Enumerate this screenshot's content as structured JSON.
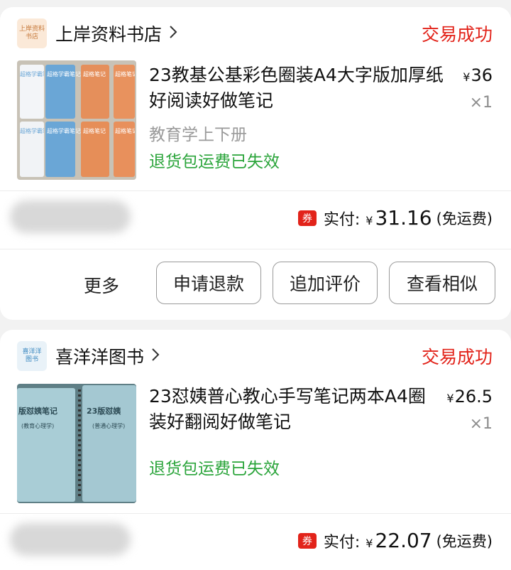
{
  "orders": [
    {
      "shop": {
        "name": "上岸资料书店",
        "logo_text": "上岸资料书店"
      },
      "status": "交易成功",
      "product": {
        "title": "23教基公基彩色圈装A4大字版加厚纸好阅读好做笔记",
        "price": "36",
        "quantity": "×1",
        "variant": "教育学上下册",
        "warning": "退货包运费已失效",
        "thumbnail_text": [
          "超格学霸笔记",
          "超格学霸笔记",
          "超格笔记",
          "超格笔记",
          "超格学霸笔记",
          "超格学霸笔记",
          "超格笔记",
          "超格笔记"
        ]
      },
      "payment": {
        "coupon_icon": "券",
        "label": "实付:",
        "currency": "¥",
        "amount": "31.16",
        "note": "(免运费)"
      },
      "actions": {
        "more": "更多",
        "refund": "申请退款",
        "review": "追加评价",
        "similar": "查看相似"
      }
    },
    {
      "shop": {
        "name": "喜洋洋图书",
        "logo_text": "喜洋洋图书"
      },
      "status": "交易成功",
      "product": {
        "title": "23怼姨普心教心手写笔记两本A4圈装好翻阅好做笔记",
        "price": "26.5",
        "quantity": "×1",
        "warning": "退货包运费已失效",
        "thumbnail_text": [
          "版怼姨笔记",
          "(教育心理学)",
          "23版怼姨",
          "(普通心理学)"
        ]
      },
      "payment": {
        "coupon_icon": "券",
        "label": "实付:",
        "currency": "¥",
        "amount": "22.07",
        "note": "(免运费)"
      }
    }
  ],
  "colors": {
    "status_red": "#e2231a",
    "warning_green": "#2aa43a",
    "muted_gray": "#9a9a9a",
    "page_bg": "#f2f2f2"
  },
  "icons": {
    "chevron": "chevron-right-icon",
    "coupon": "coupon-icon"
  }
}
